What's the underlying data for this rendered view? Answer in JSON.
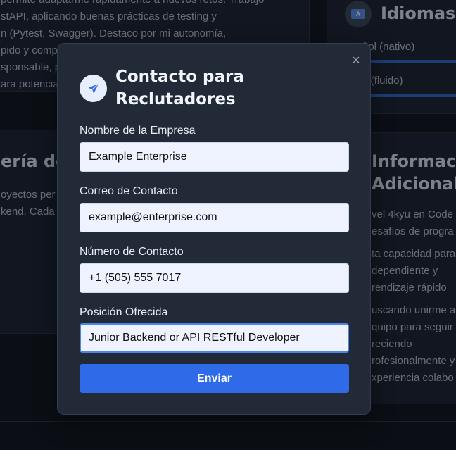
{
  "background": {
    "intro_lines": [
      "permite adaptarme rápidamente a nuevos retos. Trabajo",
      "stAPI, aplicando buenas prácticas de testing y",
      "n (Pytest, Swagger). Destaco por mi autonomía,",
      "pido y comp",
      "sponsable, p",
      "ara potencia"
    ],
    "languages": {
      "title": "Idiomas",
      "icon": "language-icon",
      "items": [
        "ñol (nativo)",
        "s (fluido)"
      ]
    },
    "projects": {
      "title": "ería de",
      "lines": [
        "oyectos per",
        "kend. Cada"
      ]
    },
    "additional": {
      "title_lines": [
        "Informaci",
        "Adicional"
      ],
      "lines": [
        "vel 4kyu en Code",
        "esafíos de progra",
        "ta capacidad para",
        "dependiente y",
        "rendizaje rápido",
        "uscando unirme a",
        "quipo para seguir",
        "reciendo",
        "rofesionalmente y",
        "xperiencia colabo"
      ]
    }
  },
  "modal": {
    "title": "Contacto para Reclutadores",
    "icon": "paper-plane-icon",
    "close_icon": "close-icon",
    "fields": [
      {
        "label": "Nombre de la Empresa",
        "value": "Example Enterprise"
      },
      {
        "label": "Correo de Contacto",
        "value": "example@enterprise.com"
      },
      {
        "label": "Número de Contacto",
        "value": "+1 (505) 555 7017"
      },
      {
        "label": "Posición Ofrecida",
        "value": "Junior Backend or API RESTful Developer"
      }
    ],
    "submit_label": "Enviar"
  },
  "colors": {
    "accent": "#2f6ae8",
    "modal_bg": "#222a38",
    "page_bg": "#0f141d"
  }
}
